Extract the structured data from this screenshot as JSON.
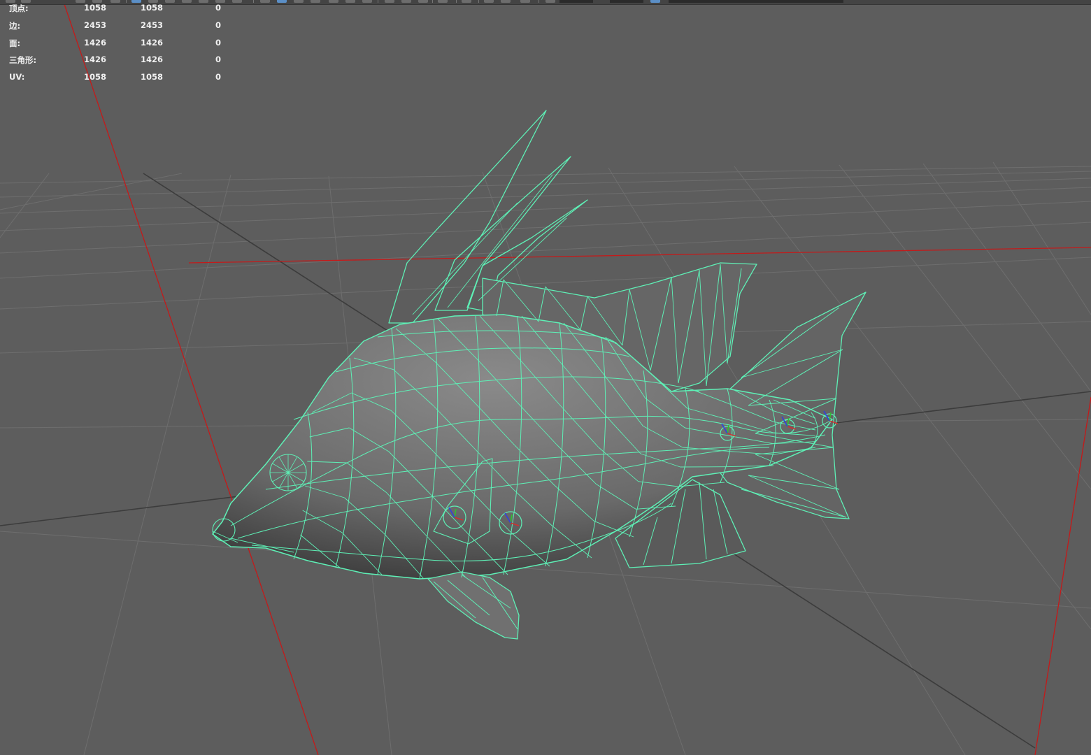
{
  "hud": {
    "rows": [
      {
        "label": "顶点:",
        "a": "1058",
        "b": "1058",
        "c": "0"
      },
      {
        "label": "边:",
        "a": "2453",
        "b": "2453",
        "c": "0"
      },
      {
        "label": "面:",
        "a": "1426",
        "b": "1426",
        "c": "0"
      },
      {
        "label": "三角形:",
        "a": "1426",
        "b": "1426",
        "c": "0"
      },
      {
        "label": "UV:",
        "a": "1058",
        "b": "1058",
        "c": "0"
      }
    ]
  },
  "toolbar": {
    "icons": [
      "select-icon",
      "lasso-icon",
      "paint-icon",
      "move-icon",
      "grid-icon",
      "grid-icon",
      "grid-icon",
      "snap-icon",
      "snap-icon",
      "snap-icon",
      "camera-icon",
      "light-icon",
      "render-icon",
      "isolate-icon",
      "xray-icon",
      "wireframe-icon",
      "shaded-icon",
      "textured-icon",
      "frame-icon",
      "bookmark-icon",
      "help-icon"
    ]
  },
  "viewport": {
    "background": "#5d5d5d",
    "grid_color": "#6e6e6e",
    "grid_axis_color": "#3c3c3c",
    "axis_color": "#c41a1a",
    "wire_color": "#5ef0b6",
    "manipulator_colors": {
      "x": "#d03030",
      "y": "#30c030",
      "z": "#3040e0"
    }
  }
}
